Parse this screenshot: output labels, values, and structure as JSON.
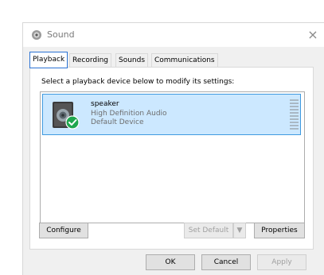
{
  "window": {
    "title": "Sound",
    "close_glyph": "×"
  },
  "tabs": [
    {
      "label": "Playback",
      "active": true
    },
    {
      "label": "Recording",
      "active": false
    },
    {
      "label": "Sounds",
      "active": false
    },
    {
      "label": "Communications",
      "active": false
    }
  ],
  "playback": {
    "instruction": "Select a playback device below to modify its settings:",
    "devices": [
      {
        "name": "speaker",
        "description": "High Definition Audio",
        "status": "Default Device",
        "icon": "speaker-icon",
        "badge": "default-check-icon",
        "selected": true
      }
    ],
    "buttons": {
      "configure": "Configure",
      "set_default": "Set Default",
      "set_default_arrow": "▼",
      "properties": "Properties"
    }
  },
  "footer": {
    "ok": "OK",
    "cancel": "Cancel",
    "apply": "Apply"
  },
  "colors": {
    "selection_bg": "#cce8ff",
    "selection_border": "#3f9ae0",
    "check_badge": "#1fa74f",
    "active_tab_border": "#2b73d4"
  }
}
